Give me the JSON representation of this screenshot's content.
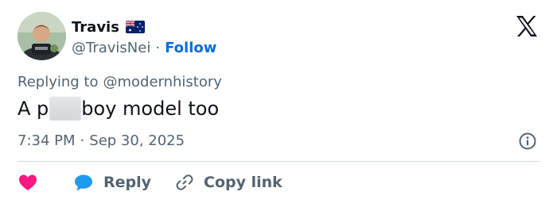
{
  "author": {
    "display_name": "Travis",
    "handle": "@TravisNei",
    "follow_label": "Follow",
    "separator": "·"
  },
  "tweet": {
    "reply_prefix": "Replying to",
    "reply_mention": "@modernhistory",
    "text_start": "A p",
    "text_end": "boy model too",
    "time": "7:34 PM",
    "date": "Sep 30, 2025"
  },
  "actions": {
    "reply_label": "Reply",
    "copy_link_label": "Copy link"
  },
  "icons": {
    "flag": "australia-flag-icon",
    "logo": "x-logo-icon",
    "info": "info-icon",
    "like": "heart-icon",
    "reply": "chat-bubble-icon",
    "copy": "link-icon"
  },
  "colors": {
    "text_primary": "#0f1419",
    "text_secondary": "#536471",
    "follow_blue": "#006fd6",
    "like_pink": "#f91880",
    "reply_blue": "#1d9bf0",
    "divider": "#cfd9de"
  }
}
